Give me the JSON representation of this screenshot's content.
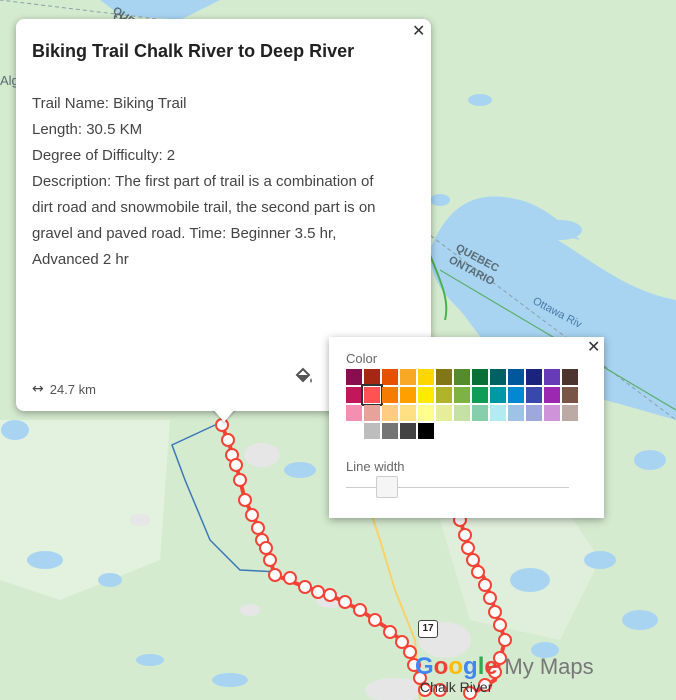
{
  "popup": {
    "title": "Biking Trail Chalk River to Deep River",
    "close_glyph": "✕",
    "lines": [
      "Trail Name: Biking Trail",
      "Length: 30.5 KM",
      "Degree of Difficulty: 2",
      "Description: The first part of trail is a combination of dirt road and snowmobile trail, the second part is on gravel and paved road. Time: Beginner 3.5 hr, Advanced 2 hr"
    ],
    "distance_icon": "↔",
    "distance": "24.7 km",
    "paint_icon": "paint-bucket-icon"
  },
  "style_picker": {
    "close_glyph": "✕",
    "color_label": "Color",
    "line_width_label": "Line width",
    "line_width_value": 0.15,
    "selected_color": "#ff5252",
    "palette_rows": [
      [
        "#880e4f",
        "#a52714",
        "#e65100",
        "#f9a825",
        "#ffd600",
        "#817717",
        "#558b2f",
        "#097138",
        "#006064",
        "#01579b",
        "#1a237e",
        "#673ab7",
        "#4e342e"
      ],
      [
        "#c2185b",
        "#ff5252",
        "#f57c00",
        "#ffa000",
        "#ffea00",
        "#afb42b",
        "#7cb342",
        "#0f9d58",
        "#0097a7",
        "#0288d1",
        "#3949ab",
        "#9c27b0",
        "#795548"
      ],
      [
        "#f48fb1",
        "#e6a39a",
        "#ffcc80",
        "#ffe082",
        "#ffff8d",
        "#e6ee9c",
        "#c5e1a5",
        "#87ceac",
        "#b2ebf2",
        "#9fc3e7",
        "#9fa8da",
        "#ce93d8",
        "#bcaaa4"
      ],
      [
        "#ffffff",
        "#bdbdbd",
        "#757575",
        "#424242",
        "#000000"
      ]
    ]
  },
  "map": {
    "labels": [
      "QUEBEC",
      "ONTARIO",
      "Ottawa Riv",
      "QUEBEC",
      "ONTARIO",
      "Alg"
    ],
    "highway": "17",
    "town": "Chalk River",
    "logo_google": [
      "G",
      "o",
      "o",
      "g",
      "l",
      "e"
    ],
    "logo_google_colors": [
      "#4285f4",
      "#ea4335",
      "#fbbc05",
      "#4285f4",
      "#34a853",
      "#ea4335"
    ],
    "logo_product": "My Maps",
    "route_color": "#f44336",
    "water_color": "#a8d4f2",
    "land_color": "#d7edd2"
  }
}
